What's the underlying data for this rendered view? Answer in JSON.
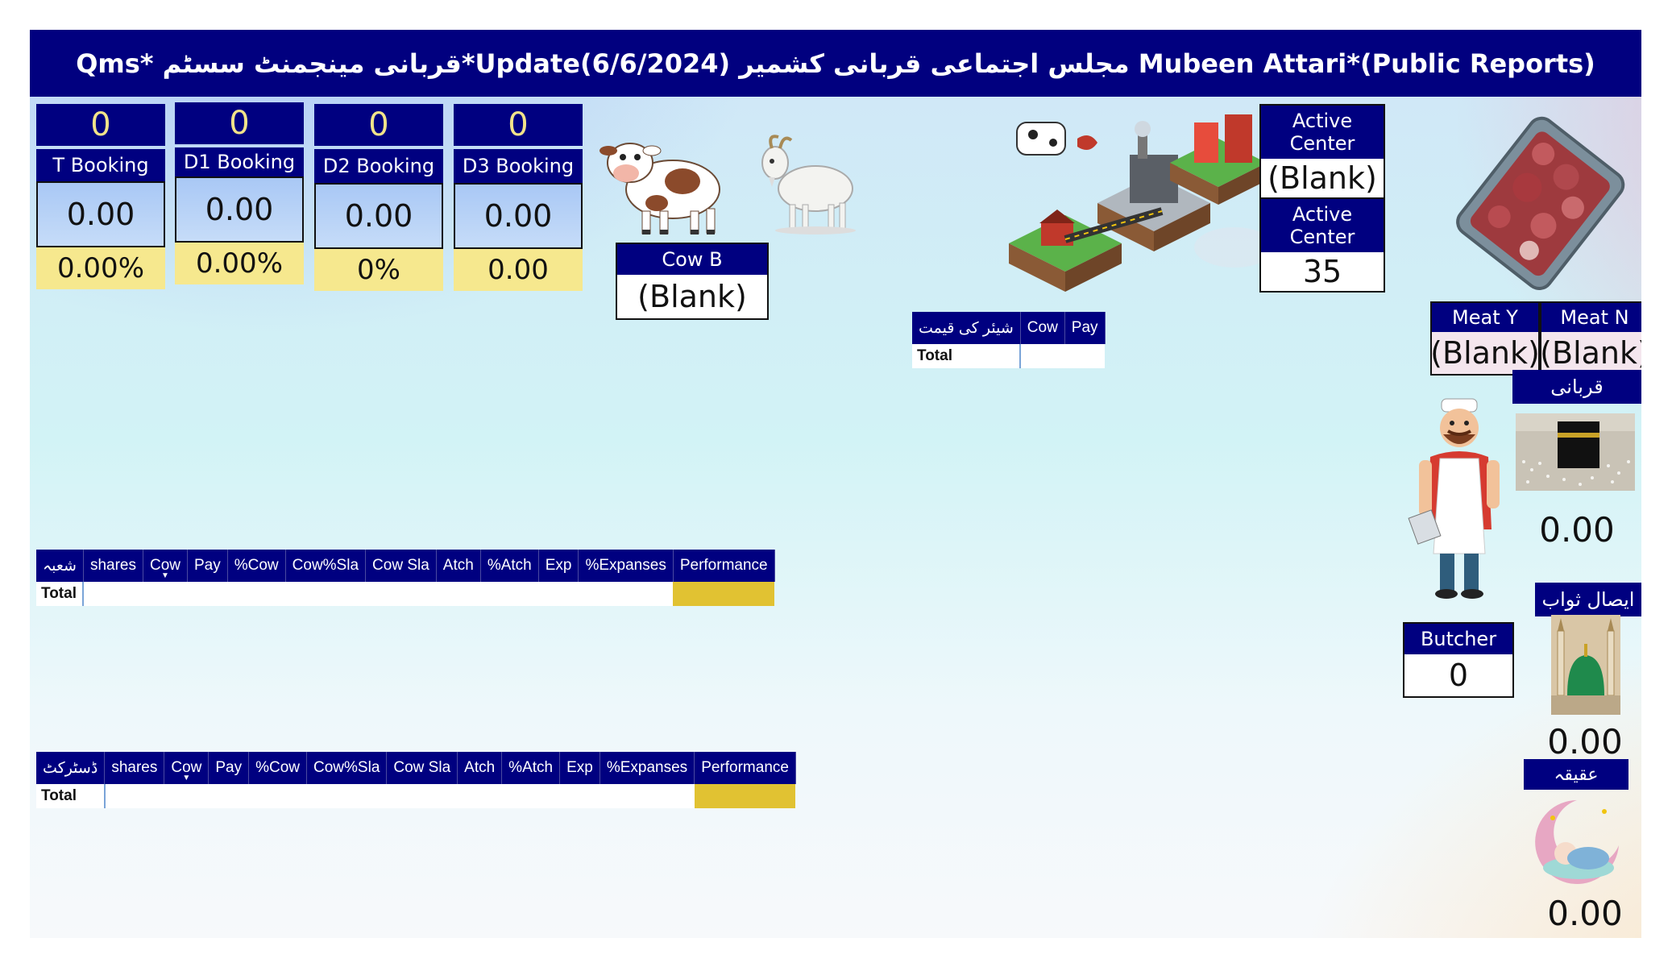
{
  "header": {
    "title": "(Public Reports)*Mubeen Attari  مجلس اجتماعی قربانی کشمیر Update(6/6/2024)*قربانی مینجمنٹ سسٹم  *Qms"
  },
  "kpis": [
    {
      "count": "0",
      "label": "T Booking",
      "amount": "0.00",
      "pct": "0.00%"
    },
    {
      "count": "0",
      "label": "D1 Booking",
      "amount": "0.00",
      "pct": "0.00%"
    },
    {
      "count": "0",
      "label": "D2 Booking",
      "amount": "0.00",
      "pct": "0%"
    },
    {
      "count": "0",
      "label": "D3 Booking",
      "amount": "0.00",
      "pct": "0.00"
    }
  ],
  "cow_b": {
    "label": "Cow B",
    "value": "(Blank)"
  },
  "active_center_1": {
    "label": "Active Center",
    "value": "(Blank)"
  },
  "active_center_2": {
    "label": "Active Center",
    "value": "35"
  },
  "meat_y": {
    "label": "Meat Y",
    "value": "(Blank)"
  },
  "meat_n": {
    "label": "Meat N",
    "value": "(Blank)"
  },
  "share_table": {
    "headers": [
      "شیئر کی قیمت",
      "Cow",
      "Pay"
    ],
    "total_label": "Total"
  },
  "qurbani": {
    "label": "قربانی",
    "value": "0.00"
  },
  "isal_sawab": {
    "label": "ایصال ثواب",
    "value": "0.00"
  },
  "aqiqa": {
    "label": "عقیقہ",
    "value": "0.00"
  },
  "butcher": {
    "label": "Butcher",
    "value": "0"
  },
  "table_shoba": {
    "headers": [
      "شعبہ",
      "shares",
      "Cow",
      "Pay",
      "%Cow",
      "Cow%Sla",
      "Cow Sla",
      "Atch",
      "%Atch",
      "Exp",
      "%Expanses",
      "Performance"
    ],
    "total_label": "Total"
  },
  "table_district": {
    "headers": [
      "ڈسٹرکٹ",
      "shares",
      "Cow",
      "Pay",
      "%Cow",
      "Cow%Sla",
      "Cow Sla",
      "Atch",
      "%Atch",
      "Exp",
      "%Expanses",
      "Performance"
    ],
    "total_label": "Total"
  },
  "icons": [
    "cow-icon",
    "goat-icon",
    "farm-to-restaurant-icon",
    "meat-tray-icon",
    "kaaba-icon",
    "butcher-icon",
    "mosque-dome-icon",
    "baby-moon-icon",
    "sort-caret-icon"
  ],
  "colors": {
    "header": "#01007f",
    "label_bg": "#000080",
    "kpi_count": "#f2e38a",
    "pct_bg": "#f6e88e",
    "performance": "#e1c232"
  }
}
